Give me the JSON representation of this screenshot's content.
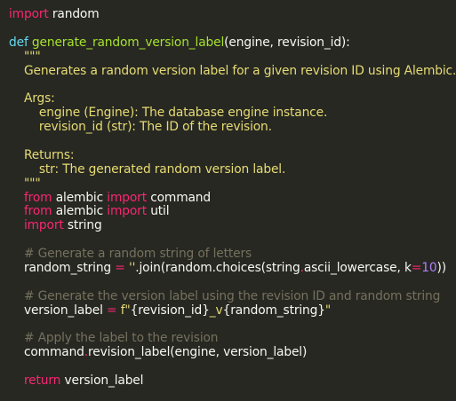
{
  "theme": {
    "background": "#272822",
    "text": "#f8f8f2",
    "keyword": "#f92672",
    "definition": "#66d9ef",
    "function": "#a6e22e",
    "string": "#e6db74",
    "number": "#ae81ff",
    "comment": "#75715e"
  },
  "code": {
    "l1": {
      "kw": "import",
      "rest": " random"
    },
    "l3": {
      "def": "def",
      "name": "generate_random_version_label",
      "params": "(engine, revision_id):"
    },
    "l4": "    \"\"\"",
    "l5": "    Generates a random version label for a given revision ID using Alembic.",
    "l7": "    Args:",
    "l8": "        engine (Engine): The database engine instance.",
    "l9": "        revision_id (str): The ID of the revision.",
    "l11": "    Returns:",
    "l12": "        str: The generated random version label.",
    "l13": "    \"\"\"",
    "l14": {
      "indent": "    ",
      "kw1": "from",
      "mod": " alembic ",
      "kw2": "import",
      "name": " command"
    },
    "l15": {
      "indent": "    ",
      "kw1": "from",
      "mod": " alembic ",
      "kw2": "import",
      "name": " util"
    },
    "l16": {
      "indent": "    ",
      "kw": "import",
      "name": " string"
    },
    "l18": "    # Generate a random string of letters",
    "l19": {
      "indent": "    ",
      "a": "random_string ",
      "op1": "=",
      "sp": " ",
      "s": "''",
      "b": ".join(random.choices(string",
      "dot": ".",
      "c": "ascii_lowercase, k",
      "op2": "=",
      "n": "10",
      "d": "))"
    },
    "l21": "    # Generate the version label using the revision ID and random string",
    "l22": {
      "indent": "    ",
      "a": "version_label ",
      "op": "=",
      "sp": " ",
      "s1": "f\"",
      "v1": "{revision_id}",
      "s2": "_v",
      "v2": "{random_string}",
      "s3": "\""
    },
    "l24": "    # Apply the label to the revision",
    "l25": {
      "indent": "    ",
      "a": "command",
      "dot": ".",
      "b": "revision_label(engine, version_label)"
    },
    "l27": {
      "indent": "    ",
      "kw": "return",
      "rest": " version_label"
    }
  }
}
